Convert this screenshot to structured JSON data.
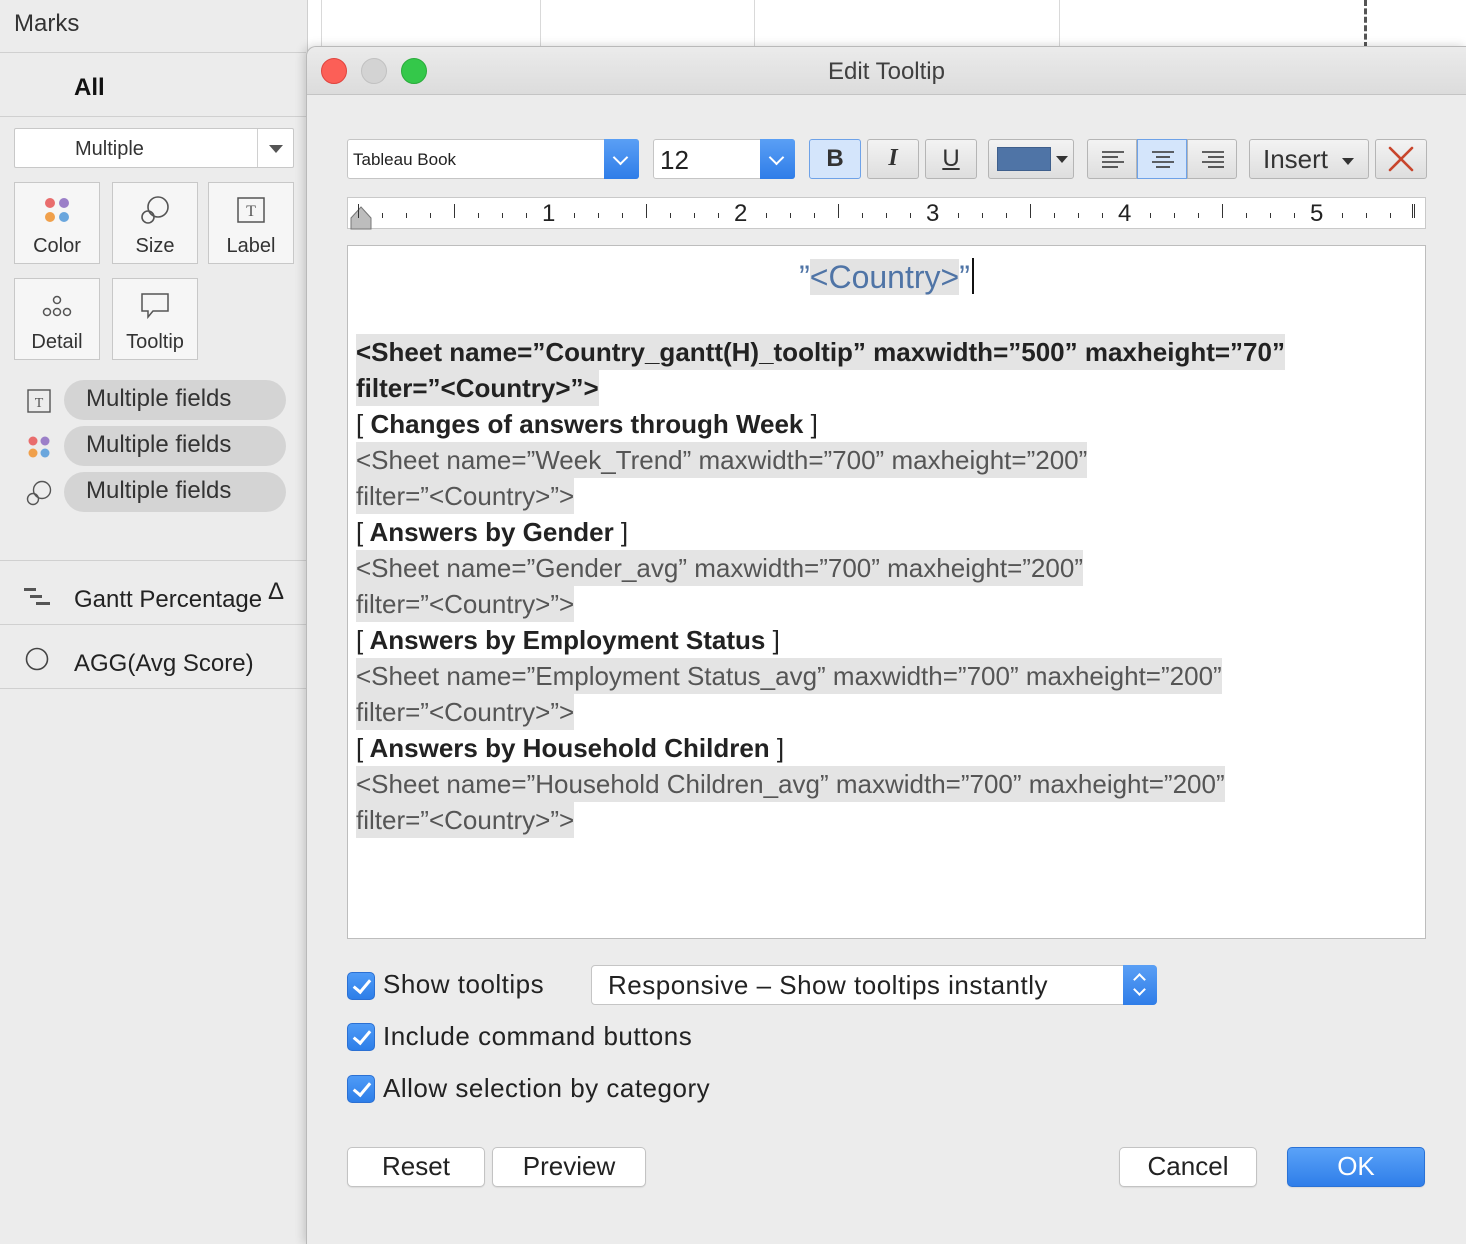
{
  "marks": {
    "title": "Marks",
    "all_label": "All",
    "mark_type": "Multiple",
    "cards": [
      {
        "label": "Color",
        "icon": "color-dots-icon"
      },
      {
        "label": "Size",
        "icon": "size-circles-icon"
      },
      {
        "label": "Label",
        "icon": "label-t-icon"
      },
      {
        "label": "Detail",
        "icon": "detail-dots-icon"
      },
      {
        "label": "Tooltip",
        "icon": "tooltip-bubble-icon"
      }
    ],
    "pills": [
      {
        "icon": "label-t-icon",
        "label": "Multiple fields"
      },
      {
        "icon": "color-dots-icon",
        "label": "Multiple fields"
      },
      {
        "icon": "size-circles-icon",
        "label": "Multiple fields"
      }
    ],
    "fields": [
      {
        "icon": "gantt-icon",
        "label": "Gantt Percentage",
        "suffix": "Δ"
      },
      {
        "icon": "circle-icon",
        "label": "AGG(Avg Score)"
      }
    ]
  },
  "dialog": {
    "title": "Edit Tooltip",
    "toolbar": {
      "font": "Tableau Book",
      "size": "12",
      "bold": "B",
      "italic": "I",
      "underline": "U",
      "text_color": "#4f74a6",
      "insert": "Insert",
      "align_selected": "center"
    },
    "ruler": {
      "numbers": [
        "1",
        "2",
        "3",
        "4",
        "5"
      ]
    },
    "editor": {
      "title_prefix": "”",
      "title_field": "<Country>",
      "title_suffix": "”",
      "lines": [
        {
          "text": "<Sheet name=”Country_gantt(H)_tooltip” maxwidth=”500” maxheight=”70”",
          "style": "bold hl"
        },
        {
          "text": "filter=”<Country>”>",
          "style": "bold hl"
        },
        {
          "bracket_open": "[",
          "text": " Changes of answers through Week ",
          "bracket_close": "]",
          "style": "heading"
        },
        {
          "text": "<Sheet name=”Week_Trend” maxwidth=”700” maxheight=”200”",
          "style": "grey hl"
        },
        {
          "text": "filter=”<Country>”>",
          "style": "grey hl"
        },
        {
          "bracket_open": "[",
          "text": " Answers by Gender ",
          "bracket_close": "]",
          "style": "heading"
        },
        {
          "text": "<Sheet name=”Gender_avg” maxwidth=”700” maxheight=”200”",
          "style": "grey hl"
        },
        {
          "text": "filter=”<Country>”>",
          "style": "grey hl"
        },
        {
          "bracket_open": "[",
          "text": " Answers by Employment Status ",
          "bracket_close": "]",
          "style": "heading"
        },
        {
          "text": "<Sheet name=”Employment Status_avg” maxwidth=”700” maxheight=”200”",
          "style": "grey hl"
        },
        {
          "text": "filter=”<Country>”>",
          "style": "grey hl"
        },
        {
          "bracket_open": "[",
          "text": " Answers by Household Children ",
          "bracket_close": "]",
          "style": "heading"
        },
        {
          "text": "<Sheet name=”Household Children_avg” maxwidth=”700” maxheight=”200”",
          "style": "grey hl"
        },
        {
          "text": "filter=”<Country>”>",
          "style": "grey hl"
        }
      ]
    },
    "options": {
      "show_tooltips": {
        "label": "Show tooltips",
        "checked": true
      },
      "behavior": "Responsive – Show tooltips instantly",
      "include_buttons": {
        "label": "Include command buttons",
        "checked": true
      },
      "allow_selection": {
        "label": "Allow selection by category",
        "checked": true
      }
    },
    "buttons": {
      "reset": "Reset",
      "preview": "Preview",
      "cancel": "Cancel",
      "ok": "OK"
    }
  }
}
